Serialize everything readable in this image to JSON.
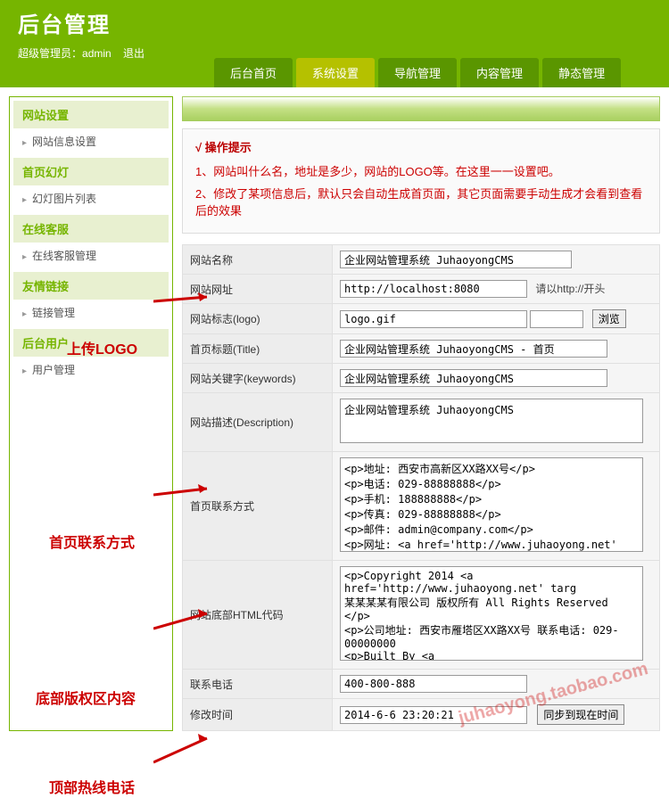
{
  "header": {
    "title": "后台管理",
    "admin_prefix": "超级管理员：",
    "admin_name": "admin",
    "logout": "退出"
  },
  "tabs": [
    {
      "label": "后台首页",
      "active": false
    },
    {
      "label": "系统设置",
      "active": true
    },
    {
      "label": "导航管理",
      "active": false
    },
    {
      "label": "内容管理",
      "active": false
    },
    {
      "label": "静态管理",
      "active": false
    }
  ],
  "sidebar": [
    {
      "title": "网站设置",
      "items": [
        "网站信息设置"
      ]
    },
    {
      "title": "首页幻灯",
      "items": [
        "幻灯图片列表"
      ]
    },
    {
      "title": "在线客服",
      "items": [
        "在线客服管理"
      ]
    },
    {
      "title": "友情链接",
      "items": [
        "链接管理"
      ]
    },
    {
      "title": "后台用户",
      "items": [
        "用户管理"
      ]
    }
  ],
  "tips": {
    "title": "√ 操作提示",
    "lines": [
      "1、网站叫什么名，地址是多少，网站的LOGO等。在这里一一设置吧。",
      "2、修改了某项信息后，默认只会自动生成首页面，其它页面需要手动生成才会看到查看后的效果"
    ]
  },
  "form": {
    "site_name": {
      "label": "网站名称",
      "value": "企业网站管理系统 JuhaoyongCMS"
    },
    "site_url": {
      "label": "网站网址",
      "value": "http://localhost:8080",
      "hint": "请以http://开头"
    },
    "logo": {
      "label": "网站标志(logo)",
      "value": "logo.gif",
      "browse": "浏览"
    },
    "title": {
      "label": "首页标题(Title)",
      "value": "企业网站管理系统 JuhaoyongCMS - 首页"
    },
    "keywords": {
      "label": "网站关键字(keywords)",
      "value": "企业网站管理系统 JuhaoyongCMS"
    },
    "description": {
      "label": "网站描述(Description)",
      "value": "企业网站管理系统 JuhaoyongCMS"
    },
    "contact": {
      "label": "首页联系方式",
      "value": "<p>地址: 西安市高新区XX路XX号</p>\n<p>电话: 029-88888888</p>\n<p>手机: 188888888</p>\n<p>传真: 029-88888888</p>\n<p>邮件: admin@company.com</p>\n<p>网址: <a href='http://www.juhaoyong.net' target='_blan"
    },
    "footer": {
      "label": "网站底部HTML代码",
      "value": "<p>Copyright 2014 <a href='http://www.juhaoyong.net' targ\n某某某某有限公司 版权所有 All Rights Reserved </p>\n<p>公司地址: 西安市雁塔区XX路XX号 联系电话: 029-00000000\n<p>Built By <a href='http://www.juhaoyong.net/' target='_\n<a href='http://www.juhaoyong.net/' target='_blank'>聚好\n技术支持 <a href='/rss' target='_blank'><img src='/images\n<a href='/rss' target='_blank'><img src='/images/xml."
    },
    "phone": {
      "label": "联系电话",
      "value": "400-800-888"
    },
    "update_time": {
      "label": "修改时间",
      "value": "2014-6-6 23:20:21",
      "sync": "同步到现在时间"
    }
  },
  "annotations": {
    "a1": "上传LOGO",
    "a2": "首页联系方式",
    "a3": "底部版权区内容",
    "a4": "顶部热线电话"
  },
  "watermark": "juhaoyong.taobao.com"
}
